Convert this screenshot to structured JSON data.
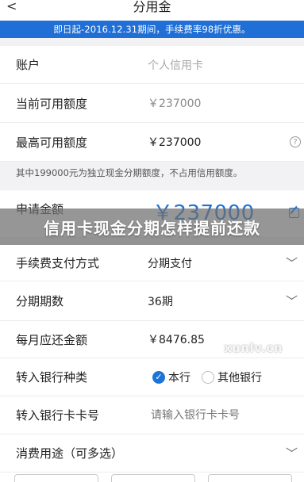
{
  "header": {
    "title": "分用金",
    "back_icon": "chevron-left-icon"
  },
  "promo": {
    "text": "即日起-2016.12.31期间，手续费率98折优惠。"
  },
  "rows": {
    "account": {
      "label": "账户",
      "value": "个人信用卡"
    },
    "current_limit": {
      "label": "当前可用额度",
      "value": "￥237000"
    },
    "max_limit": {
      "label": "最高可用额度",
      "value": "￥237000"
    },
    "note": "其中199000元为独立现金分期额度，不占用信用额度。",
    "apply_amount": {
      "label": "申请金额",
      "value": "￥237000"
    },
    "fee_method": {
      "label": "手续费支付方式",
      "value": "分期支付"
    },
    "installments": {
      "label": "分期期数",
      "value": "36期"
    },
    "monthly": {
      "label": "每月应还金额",
      "value": "￥8476.85"
    },
    "bank_type": {
      "label": "转入银行种类",
      "options": [
        "本行",
        "其他银行"
      ],
      "selected": "本行"
    },
    "card_no": {
      "label": "转入银行卡卡号",
      "placeholder": "请输入银行卡卡号"
    },
    "purpose": {
      "label": "消费用途（可多选）"
    }
  },
  "overlay": {
    "title": "信用卡现金分期怎样提前还款"
  },
  "watermark": "xunlv.cn",
  "colors": {
    "accent": "#1e74d6",
    "promo_bg": "#1f6fd6"
  }
}
